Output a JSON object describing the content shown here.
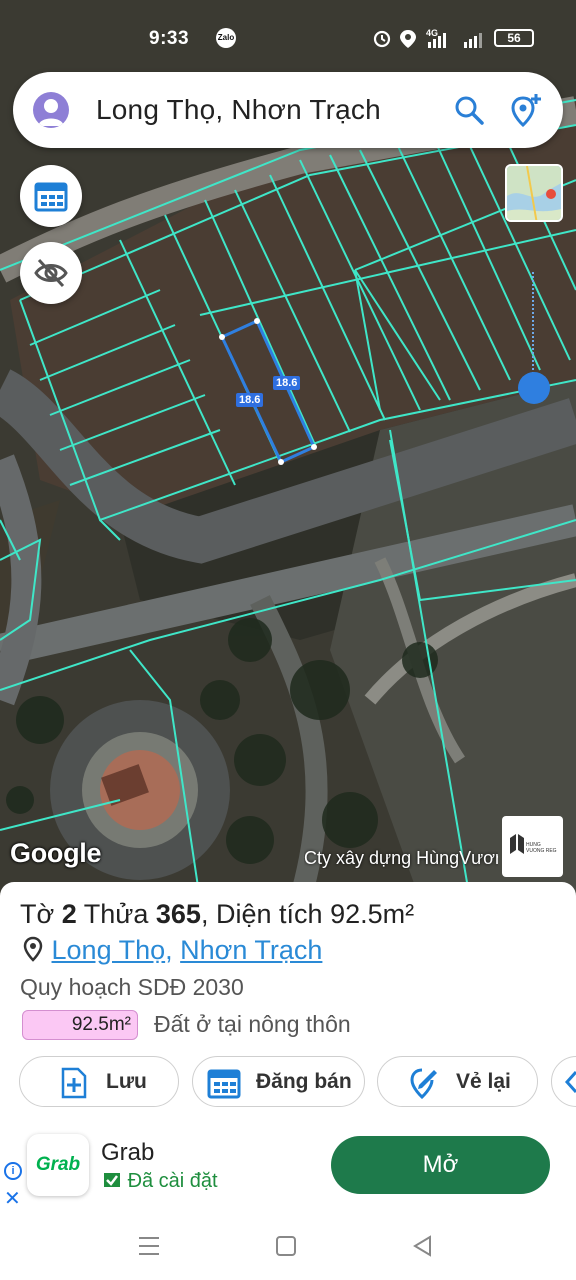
{
  "status_bar": {
    "time": "9:33",
    "notification_app": "Zalo",
    "network": "4G",
    "battery": "56",
    "icons": [
      "alarm-icon",
      "location-icon",
      "signal-icon",
      "battery-icon"
    ]
  },
  "search": {
    "title": "Long Thọ, Nhơn Trạch",
    "icons": [
      "avatar-icon",
      "search-icon",
      "pin-plus-icon"
    ]
  },
  "map": {
    "parcel_dimensions": [
      "18.6",
      "18.6"
    ],
    "provider": "Google",
    "watermark": "Cty xây dựng HùngVương",
    "company_logo_text": "HUNG VUONG REG",
    "zoom_level_fraction": 0.85,
    "accent": "#2f7fe0",
    "parcel_line_color": "#3fe6c8"
  },
  "parcel": {
    "sheet_label": "Tờ",
    "sheet_no": "2",
    "lot_label": "Thửa",
    "lot_no": "365",
    "area_label": "Diện tích",
    "area": "92.5m²",
    "ward": "Long Thọ",
    "district": "Nhơn Trạch",
    "plan": "Quy hoạch SDĐ 2030",
    "plan_area": "92.5m²",
    "plan_area_color": "#fbc8f4",
    "land_use": "Đất ở tại nông thôn"
  },
  "actions": {
    "save": "Lưu",
    "sell": "Đăng bán",
    "redraw": "Vẻ lại"
  },
  "ad": {
    "app_icon_text": "Grab",
    "app_name": "Grab",
    "installed": "Đã cài đặt",
    "open": "Mở",
    "button_color": "#1e7a4b"
  }
}
